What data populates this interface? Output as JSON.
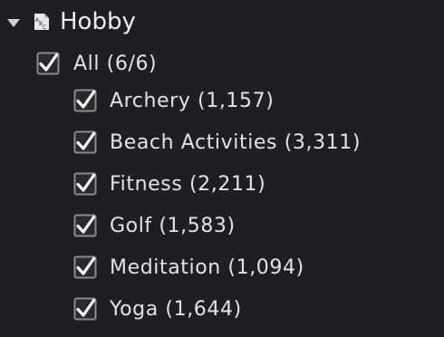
{
  "filter": {
    "field_name": "Hobby",
    "type_icon": "abc-string-icon",
    "all": {
      "label": "All (6/6)",
      "checked": true
    },
    "items": [
      {
        "label": "Archery (1,157)",
        "checked": true
      },
      {
        "label": "Beach Activities (3,311)",
        "checked": true
      },
      {
        "label": "Fitness (2,211)",
        "checked": true
      },
      {
        "label": "Golf (1,583)",
        "checked": true
      },
      {
        "label": "Meditation (1,094)",
        "checked": true
      },
      {
        "label": "Yoga (1,644)",
        "checked": true
      }
    ]
  },
  "colors": {
    "background": "#1f1f21",
    "text": "#e3e3e3",
    "checkbox_border": "#8a8a90",
    "checkmark": "#ffffff"
  }
}
